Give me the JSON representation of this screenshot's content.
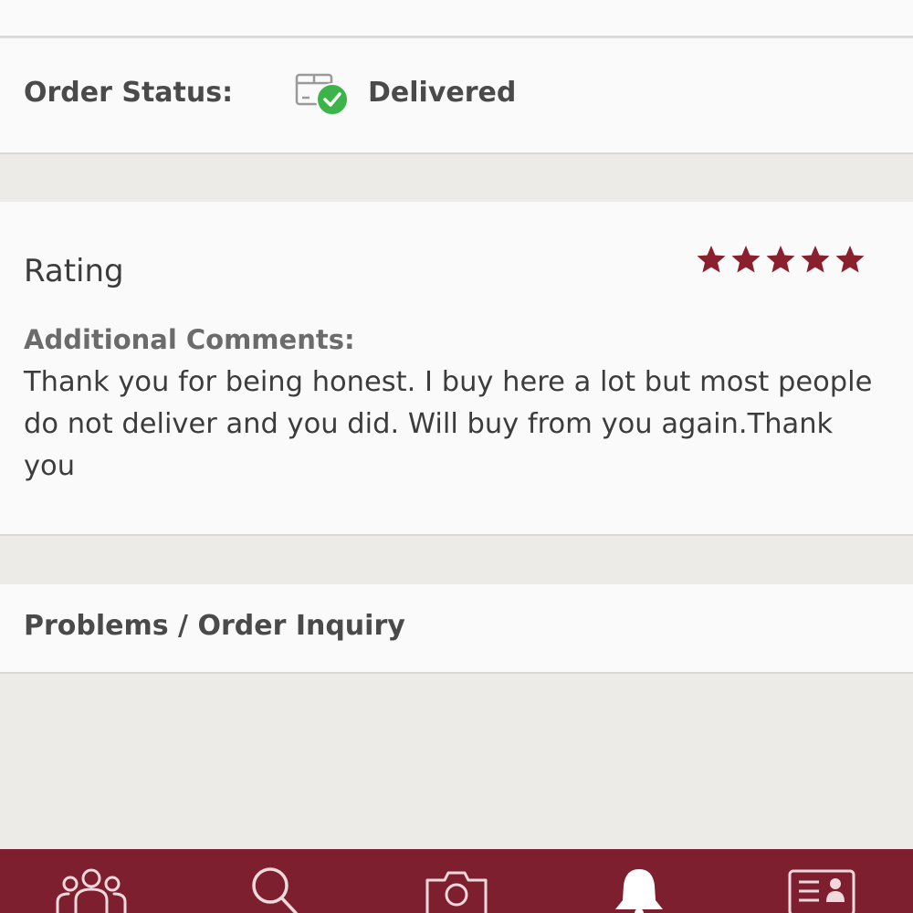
{
  "order": {
    "status_label": "Order Status:",
    "status_value": "Delivered",
    "status_icon": "delivered-box-check-icon"
  },
  "rating": {
    "label": "Rating",
    "stars": 5,
    "max_stars": 5,
    "star_color": "#8a1f2d"
  },
  "comments": {
    "label": "Additional Comments:",
    "text": "Thank you for being honest. I buy here a lot but most people do not deliver and you did. Will buy from you again.Thank you"
  },
  "problems": {
    "label": "Problems / Order Inquiry"
  },
  "tabbar": {
    "background": "#7e1f2f",
    "tabs": [
      {
        "icon": "people-icon"
      },
      {
        "icon": "search-icon"
      },
      {
        "icon": "camera-icon"
      },
      {
        "icon": "bell-icon"
      },
      {
        "icon": "profile-card-icon"
      }
    ]
  },
  "colors": {
    "accent": "#7e1f2f",
    "success": "#3cb449",
    "text": "#4a4a4a"
  }
}
